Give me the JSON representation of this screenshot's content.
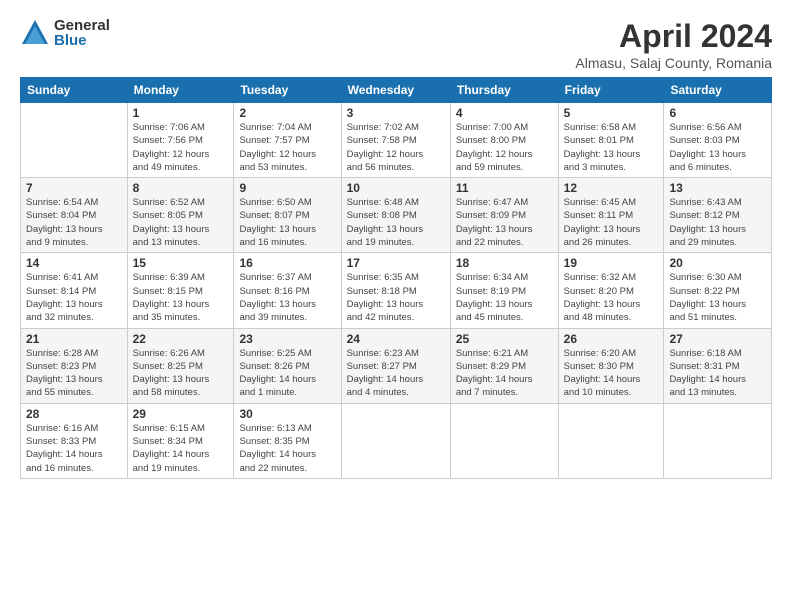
{
  "logo": {
    "general": "General",
    "blue": "Blue"
  },
  "title": "April 2024",
  "location": "Almasu, Salaj County, Romania",
  "days_of_week": [
    "Sunday",
    "Monday",
    "Tuesday",
    "Wednesday",
    "Thursday",
    "Friday",
    "Saturday"
  ],
  "weeks": [
    [
      {
        "day": "",
        "info": ""
      },
      {
        "day": "1",
        "info": "Sunrise: 7:06 AM\nSunset: 7:56 PM\nDaylight: 12 hours\nand 49 minutes."
      },
      {
        "day": "2",
        "info": "Sunrise: 7:04 AM\nSunset: 7:57 PM\nDaylight: 12 hours\nand 53 minutes."
      },
      {
        "day": "3",
        "info": "Sunrise: 7:02 AM\nSunset: 7:58 PM\nDaylight: 12 hours\nand 56 minutes."
      },
      {
        "day": "4",
        "info": "Sunrise: 7:00 AM\nSunset: 8:00 PM\nDaylight: 12 hours\nand 59 minutes."
      },
      {
        "day": "5",
        "info": "Sunrise: 6:58 AM\nSunset: 8:01 PM\nDaylight: 13 hours\nand 3 minutes."
      },
      {
        "day": "6",
        "info": "Sunrise: 6:56 AM\nSunset: 8:03 PM\nDaylight: 13 hours\nand 6 minutes."
      }
    ],
    [
      {
        "day": "7",
        "info": "Sunrise: 6:54 AM\nSunset: 8:04 PM\nDaylight: 13 hours\nand 9 minutes."
      },
      {
        "day": "8",
        "info": "Sunrise: 6:52 AM\nSunset: 8:05 PM\nDaylight: 13 hours\nand 13 minutes."
      },
      {
        "day": "9",
        "info": "Sunrise: 6:50 AM\nSunset: 8:07 PM\nDaylight: 13 hours\nand 16 minutes."
      },
      {
        "day": "10",
        "info": "Sunrise: 6:48 AM\nSunset: 8:08 PM\nDaylight: 13 hours\nand 19 minutes."
      },
      {
        "day": "11",
        "info": "Sunrise: 6:47 AM\nSunset: 8:09 PM\nDaylight: 13 hours\nand 22 minutes."
      },
      {
        "day": "12",
        "info": "Sunrise: 6:45 AM\nSunset: 8:11 PM\nDaylight: 13 hours\nand 26 minutes."
      },
      {
        "day": "13",
        "info": "Sunrise: 6:43 AM\nSunset: 8:12 PM\nDaylight: 13 hours\nand 29 minutes."
      }
    ],
    [
      {
        "day": "14",
        "info": "Sunrise: 6:41 AM\nSunset: 8:14 PM\nDaylight: 13 hours\nand 32 minutes."
      },
      {
        "day": "15",
        "info": "Sunrise: 6:39 AM\nSunset: 8:15 PM\nDaylight: 13 hours\nand 35 minutes."
      },
      {
        "day": "16",
        "info": "Sunrise: 6:37 AM\nSunset: 8:16 PM\nDaylight: 13 hours\nand 39 minutes."
      },
      {
        "day": "17",
        "info": "Sunrise: 6:35 AM\nSunset: 8:18 PM\nDaylight: 13 hours\nand 42 minutes."
      },
      {
        "day": "18",
        "info": "Sunrise: 6:34 AM\nSunset: 8:19 PM\nDaylight: 13 hours\nand 45 minutes."
      },
      {
        "day": "19",
        "info": "Sunrise: 6:32 AM\nSunset: 8:20 PM\nDaylight: 13 hours\nand 48 minutes."
      },
      {
        "day": "20",
        "info": "Sunrise: 6:30 AM\nSunset: 8:22 PM\nDaylight: 13 hours\nand 51 minutes."
      }
    ],
    [
      {
        "day": "21",
        "info": "Sunrise: 6:28 AM\nSunset: 8:23 PM\nDaylight: 13 hours\nand 55 minutes."
      },
      {
        "day": "22",
        "info": "Sunrise: 6:26 AM\nSunset: 8:25 PM\nDaylight: 13 hours\nand 58 minutes."
      },
      {
        "day": "23",
        "info": "Sunrise: 6:25 AM\nSunset: 8:26 PM\nDaylight: 14 hours\nand 1 minute."
      },
      {
        "day": "24",
        "info": "Sunrise: 6:23 AM\nSunset: 8:27 PM\nDaylight: 14 hours\nand 4 minutes."
      },
      {
        "day": "25",
        "info": "Sunrise: 6:21 AM\nSunset: 8:29 PM\nDaylight: 14 hours\nand 7 minutes."
      },
      {
        "day": "26",
        "info": "Sunrise: 6:20 AM\nSunset: 8:30 PM\nDaylight: 14 hours\nand 10 minutes."
      },
      {
        "day": "27",
        "info": "Sunrise: 6:18 AM\nSunset: 8:31 PM\nDaylight: 14 hours\nand 13 minutes."
      }
    ],
    [
      {
        "day": "28",
        "info": "Sunrise: 6:16 AM\nSunset: 8:33 PM\nDaylight: 14 hours\nand 16 minutes."
      },
      {
        "day": "29",
        "info": "Sunrise: 6:15 AM\nSunset: 8:34 PM\nDaylight: 14 hours\nand 19 minutes."
      },
      {
        "day": "30",
        "info": "Sunrise: 6:13 AM\nSunset: 8:35 PM\nDaylight: 14 hours\nand 22 minutes."
      },
      {
        "day": "",
        "info": ""
      },
      {
        "day": "",
        "info": ""
      },
      {
        "day": "",
        "info": ""
      },
      {
        "day": "",
        "info": ""
      }
    ]
  ]
}
